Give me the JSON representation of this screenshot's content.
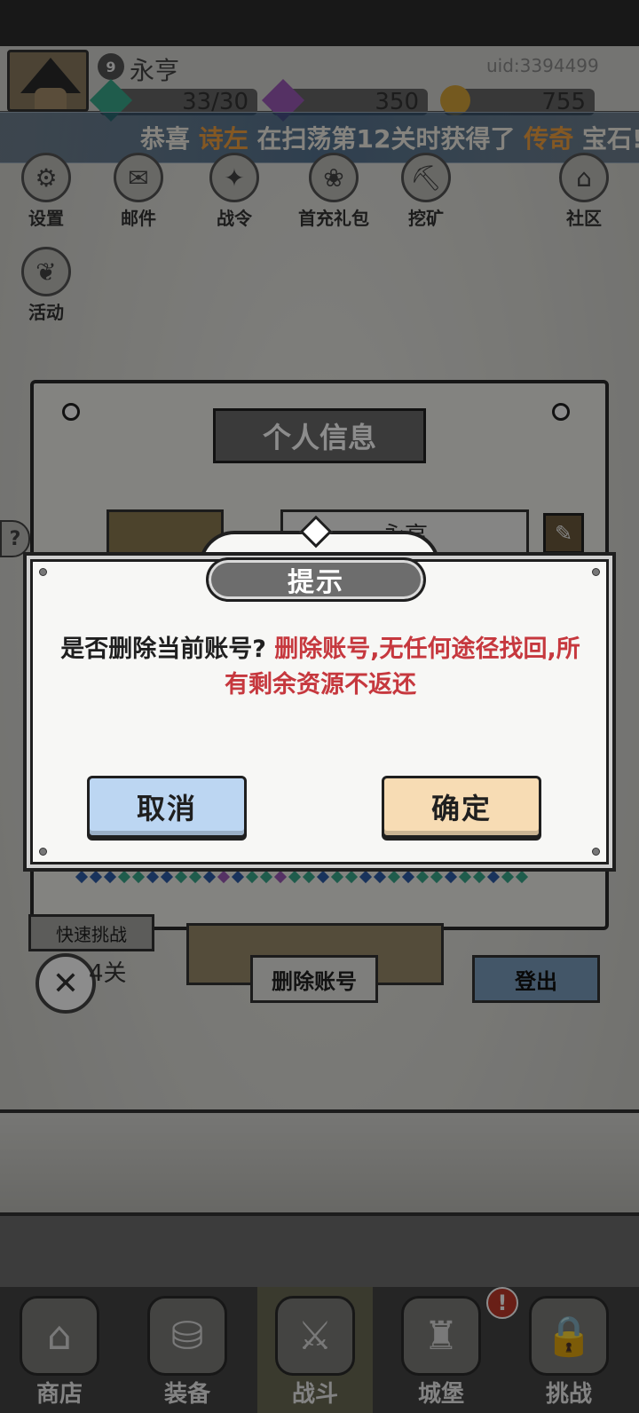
{
  "header": {
    "level": "9",
    "player_name": "永亨",
    "uid": "uid:3394499",
    "resources": [
      {
        "icon": "gem-green-icon",
        "value": "33/30",
        "color": "#3aa88a"
      },
      {
        "icon": "gem-purple-icon",
        "value": "350",
        "color": "#9b59b6"
      },
      {
        "icon": "coin-icon",
        "value": "755",
        "color": "#d4a23a"
      }
    ]
  },
  "ticker": {
    "prefix": "恭喜",
    "name": "诗左",
    "middle": "在扫荡第12关时获得了",
    "item": "传奇",
    "suffix": "宝石!"
  },
  "top_menu": [
    {
      "icon": "gear-icon",
      "label": "设置"
    },
    {
      "icon": "mail-icon",
      "label": "邮件"
    },
    {
      "icon": "battle-pass-icon",
      "label": "战令"
    },
    {
      "icon": "gift-bag-icon",
      "label": "首充礼包"
    },
    {
      "icon": "mining-icon",
      "label": "挖矿"
    },
    {
      "icon": "home-icon",
      "label": "社区"
    }
  ],
  "activity": {
    "icon": "wreath-icon",
    "label": "活动"
  },
  "profile_panel": {
    "title": "个人信息",
    "name_value": "永亨",
    "help": "?",
    "levels_text": "4关",
    "delete_button": "删除账号",
    "logout_button": "登出",
    "quick_button": "快速挑战"
  },
  "dialog": {
    "title": "提示",
    "question": "是否删除当前账号?",
    "warning": "删除账号,无任何途径找回,所有剩余资源不返还",
    "cancel_label": "取消",
    "confirm_label": "确定",
    "warning_color": "#c6383e"
  },
  "bottom_nav": [
    {
      "icon": "shop-icon",
      "label": "商店"
    },
    {
      "icon": "backpack-icon",
      "label": "装备"
    },
    {
      "icon": "crossed-swords-icon",
      "label": "战斗",
      "active": true
    },
    {
      "icon": "castle-icon",
      "label": "城堡",
      "badge": "!"
    },
    {
      "icon": "locked-challenge-icon",
      "label": "挑战"
    }
  ]
}
